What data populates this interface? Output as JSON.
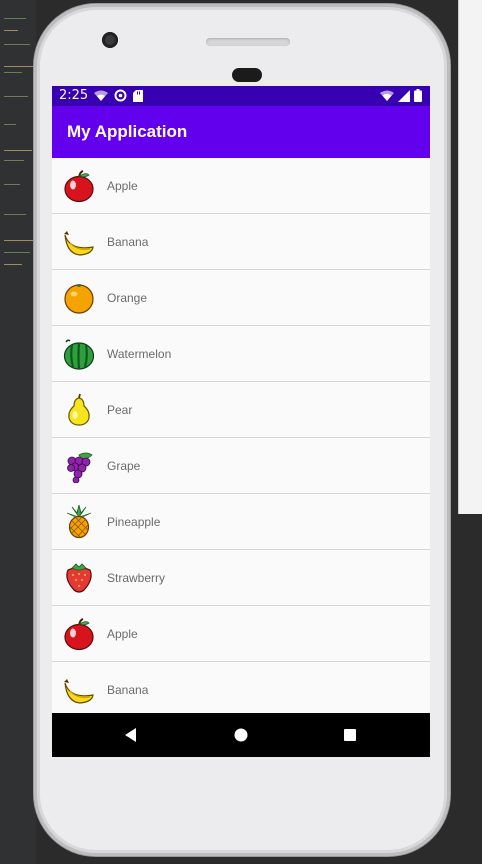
{
  "status_bar": {
    "time": "2:25"
  },
  "app_bar": {
    "title": "My Application"
  },
  "fruits": [
    {
      "name": "Apple",
      "icon": "apple-icon"
    },
    {
      "name": "Banana",
      "icon": "banana-icon"
    },
    {
      "name": "Orange",
      "icon": "orange-icon"
    },
    {
      "name": "Watermelon",
      "icon": "watermelon-icon"
    },
    {
      "name": "Pear",
      "icon": "pear-icon"
    },
    {
      "name": "Grape",
      "icon": "grape-icon"
    },
    {
      "name": "Pineapple",
      "icon": "pineapple-icon"
    },
    {
      "name": "Strawberry",
      "icon": "strawberry-icon"
    },
    {
      "name": "Apple",
      "icon": "apple-icon"
    },
    {
      "name": "Banana",
      "icon": "banana-icon"
    }
  ],
  "nav_bar": {
    "buttons": [
      "back-icon",
      "home-icon",
      "recents-icon"
    ]
  },
  "colors": {
    "primary": "#6200ee",
    "primary_dark": "#3700b3"
  }
}
